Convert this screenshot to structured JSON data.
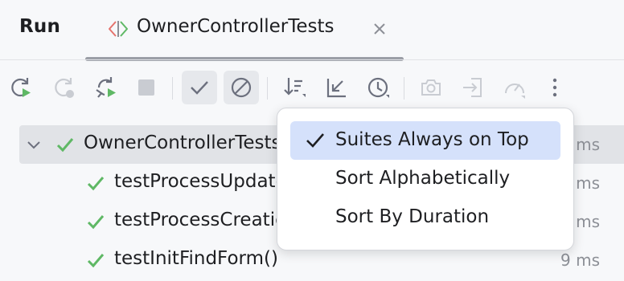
{
  "header": {
    "title": "Run",
    "tab": {
      "label": "OwnerControllerTests",
      "icon": "test-class-icon",
      "close_icon": "close-icon"
    }
  },
  "toolbar": {
    "buttons": [
      {
        "icon": "rerun-icon",
        "enabled": true
      },
      {
        "icon": "rerun-failed-icon",
        "enabled": false
      },
      {
        "icon": "toggle-auto-test-icon",
        "enabled": true
      },
      {
        "icon": "stop-icon",
        "enabled": false
      },
      {
        "icon": "show-passed-icon",
        "active": true
      },
      {
        "icon": "show-ignored-icon",
        "active": true
      },
      {
        "icon": "sort-icon",
        "enabled": true
      },
      {
        "icon": "import-tests-icon",
        "enabled": true
      },
      {
        "icon": "test-history-icon",
        "enabled": true
      },
      {
        "icon": "screenshot-icon",
        "enabled": false
      },
      {
        "icon": "export-icon",
        "enabled": false
      },
      {
        "icon": "coverage-icon",
        "enabled": false
      },
      {
        "icon": "more-icon",
        "enabled": true
      }
    ]
  },
  "tree": {
    "root": {
      "label": "OwnerControllerTests",
      "time": "ms",
      "status": "passed"
    },
    "children": [
      {
        "label": "testProcessUpdateOwnerFormSuccess()",
        "time": "ms",
        "status": "passed"
      },
      {
        "label": "testProcessCreationFormSuccess()",
        "time": "ms",
        "status": "passed"
      },
      {
        "label": "testInitFindForm()",
        "time": "9 ms",
        "status": "passed"
      }
    ]
  },
  "sort_menu": {
    "items": [
      {
        "label": "Suites Always on Top",
        "checked": true
      },
      {
        "label": "Sort Alphabetically",
        "checked": false
      },
      {
        "label": "Sort By Duration",
        "checked": false
      }
    ]
  },
  "colors": {
    "accent_selection": "#d5e1fb",
    "passed_green": "#5fb865",
    "icon_gray": "#6c707e"
  }
}
